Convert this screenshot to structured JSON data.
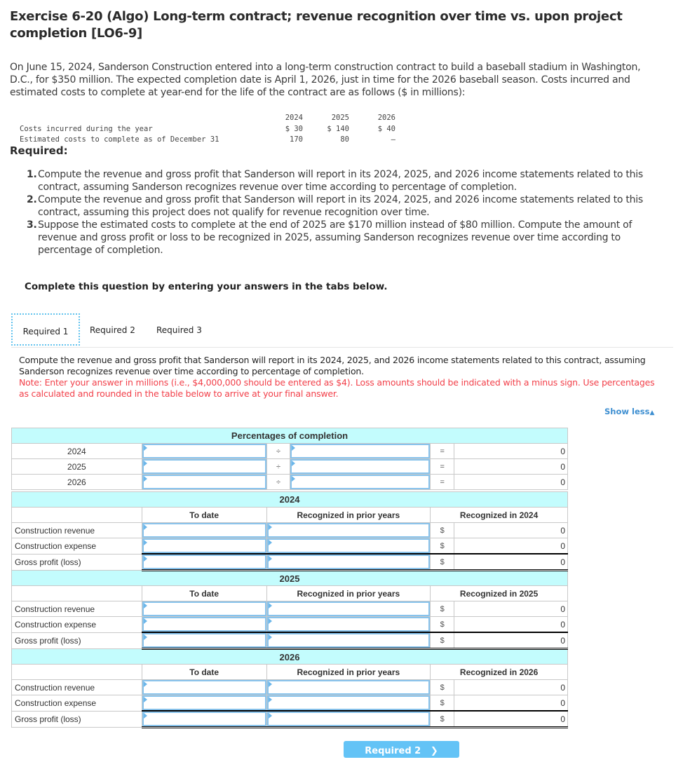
{
  "title": "Exercise 6-20 (Algo) Long-term contract; revenue recognition over time vs. upon project completion [LO6-9]",
  "intro": "On June 15, 2024, Sanderson Construction entered into a long-term construction contract to build a baseball stadium in Washington, D.C., for $350 million. The expected completion date is April 1, 2026, just in time for the 2026 baseball season. Costs incurred and estimated costs to complete at year-end for the life of the contract are as follows ($ in millions):",
  "costs_table": {
    "years": [
      "2024",
      "2025",
      "2026"
    ],
    "rows": [
      {
        "label": "Costs incurred during the year",
        "values": [
          "$ 30",
          "$ 140",
          "$ 40"
        ]
      },
      {
        "label": "Estimated costs to complete as of December 31",
        "values": [
          "170",
          "80",
          "–"
        ]
      }
    ]
  },
  "required_heading": "Required:",
  "required_items": [
    {
      "num": "1.",
      "text": "Compute the revenue and gross profit that Sanderson will report in its 2024, 2025, and 2026 income statements related to this contract, assuming Sanderson recognizes revenue over time according to percentage of completion."
    },
    {
      "num": "2.",
      "text": "Compute the revenue and gross profit that Sanderson will report in its 2024, 2025, and 2026 income statements related to this contract, assuming this project does not qualify for revenue recognition over time."
    },
    {
      "num": "3.",
      "text": "Suppose the estimated costs to complete at the end of 2025 are $170 million instead of $80 million. Compute the amount of revenue and gross profit or loss to be recognized in 2025, assuming Sanderson recognizes revenue over time according to percentage of completion."
    }
  ],
  "complete_prompt": "Complete this question by entering your answers in the tabs below.",
  "tabs": [
    {
      "label": "Required 1",
      "active": true
    },
    {
      "label": "Required 2",
      "active": false
    },
    {
      "label": "Required 3",
      "active": false
    }
  ],
  "instructions": "Compute the revenue and gross profit that Sanderson will report in its 2024, 2025, and 2026 income statements related to this contract, assuming Sanderson recognizes revenue over time according to percentage of completion.",
  "note": "Note: Enter your answer in millions (i.e., $4,000,000 should be entered as $4). Loss amounts should be indicated with a minus sign. Use percentages as calculated and rounded in the table below to arrive at your final answer.",
  "show_less": "Show less",
  "show_less_icon": "▲",
  "percent_table": {
    "heading": "Percentages of completion",
    "divide_symbol": "÷",
    "equals_symbol": "=",
    "rows": [
      {
        "year": "2024",
        "numerator": "",
        "denominator": "",
        "result": "0"
      },
      {
        "year": "2025",
        "numerator": "",
        "denominator": "",
        "result": "0"
      },
      {
        "year": "2026",
        "numerator": "",
        "denominator": "",
        "result": "0"
      }
    ]
  },
  "year_sections": [
    {
      "year": "2024",
      "col_to_date": "To date",
      "col_prior": "Recognized in prior years",
      "col_current": "Recognized in 2024",
      "rows": [
        {
          "label": "Construction revenue",
          "to_date": "",
          "prior": "",
          "currency": "$",
          "current": "0"
        },
        {
          "label": "Construction expense",
          "to_date": "",
          "prior": "",
          "currency": "$",
          "current": "0"
        },
        {
          "label": "Gross profit (loss)",
          "to_date": "",
          "prior": "",
          "currency": "$",
          "current": "0"
        }
      ]
    },
    {
      "year": "2025",
      "col_to_date": "To date",
      "col_prior": "Recognized in prior years",
      "col_current": "Recognized in 2025",
      "rows": [
        {
          "label": "Construction revenue",
          "to_date": "",
          "prior": "",
          "currency": "$",
          "current": "0"
        },
        {
          "label": "Construction expense",
          "to_date": "",
          "prior": "",
          "currency": "$",
          "current": "0"
        },
        {
          "label": "Gross profit (loss)",
          "to_date": "",
          "prior": "",
          "currency": "$",
          "current": "0"
        }
      ]
    },
    {
      "year": "2026",
      "col_to_date": "To date",
      "col_prior": "Recognized in prior years",
      "col_current": "Recognized in 2026",
      "rows": [
        {
          "label": "Construction revenue",
          "to_date": "",
          "prior": "",
          "currency": "$",
          "current": "0"
        },
        {
          "label": "Construction expense",
          "to_date": "",
          "prior": "",
          "currency": "$",
          "current": "0"
        },
        {
          "label": "Gross profit (loss)",
          "to_date": "",
          "prior": "",
          "currency": "$",
          "current": "0"
        }
      ]
    }
  ],
  "next_button": {
    "label": "Required 2",
    "icon": "❯"
  },
  "colors": {
    "header_bg": "#c3fcfd",
    "input_border": "#88c3ec",
    "note_red": "#f2404a",
    "link_blue": "#3e8fd1",
    "button_blue": "#63c3f6"
  }
}
